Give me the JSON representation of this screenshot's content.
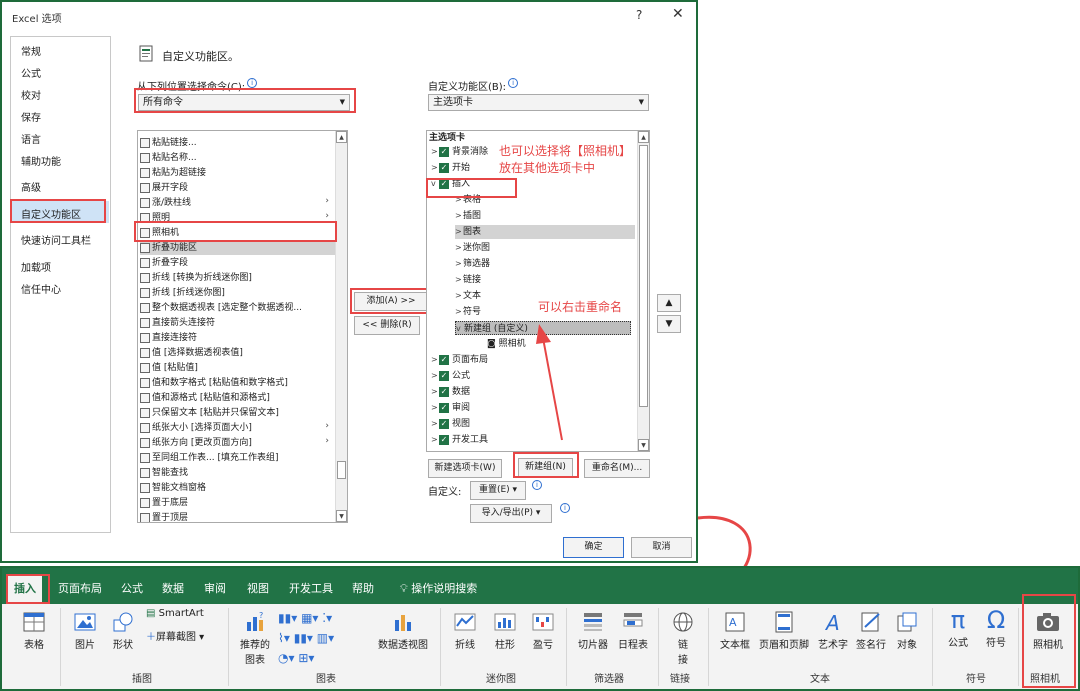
{
  "dialog": {
    "title": "Excel 选项",
    "help": "?",
    "close": "✕",
    "nav": [
      "常规",
      "公式",
      "校对",
      "保存",
      "语言",
      "辅助功能",
      "高级",
      "自定义功能区",
      "快速访问工具栏",
      "加载项",
      "信任中心"
    ],
    "header": "自定义功能区。",
    "choose_label": "从下列位置选择命令(C):",
    "choose_value": "所有命令",
    "ribbon_label": "自定义功能区(B):",
    "ribbon_value": "主选项卡",
    "commands": [
      {
        "text": "粘贴链接...",
        "chev": false
      },
      {
        "text": "粘贴名称...",
        "chev": false
      },
      {
        "text": "粘贴为超链接",
        "chev": false
      },
      {
        "text": "展开字段",
        "chev": false
      },
      {
        "text": "涨/跌柱线",
        "chev": true
      },
      {
        "text": "照明",
        "chev": true
      },
      {
        "text": "照相机",
        "chev": false
      },
      {
        "text": "折叠功能区",
        "chev": false
      },
      {
        "text": "折叠字段",
        "chev": false
      },
      {
        "text": "折线 [转换为折线迷你图]",
        "chev": false
      },
      {
        "text": "折线 [折线迷你图]",
        "chev": false
      },
      {
        "text": "整个数据透视表 [选定整个数据透视...",
        "chev": false
      },
      {
        "text": "直接箭头连接符",
        "chev": false
      },
      {
        "text": "直接连接符",
        "chev": false
      },
      {
        "text": "值 [选择数据透视表值]",
        "chev": false
      },
      {
        "text": "值 [粘贴值]",
        "chev": false
      },
      {
        "text": "值和数字格式 [粘贴值和数字格式]",
        "chev": false
      },
      {
        "text": "值和源格式 [粘贴值和源格式]",
        "chev": false
      },
      {
        "text": "只保留文本 [粘贴并只保留文本]",
        "chev": false
      },
      {
        "text": "纸张大小 [选择页面大小]",
        "chev": true
      },
      {
        "text": "纸张方向 [更改页面方向]",
        "chev": true
      },
      {
        "text": "至同组工作表... [填充工作表组]",
        "chev": false
      },
      {
        "text": "智能查找",
        "chev": false
      },
      {
        "text": "智能文档窗格",
        "chev": false
      },
      {
        "text": "置于底层",
        "chev": false
      },
      {
        "text": "置于顶层",
        "chev": false
      }
    ],
    "add_button": "添加(A) >>",
    "remove_button": "<< 删除(R)",
    "tree_header": "主选项卡",
    "tree": [
      {
        "text": "背景消除",
        "level": 0,
        "exp": ">",
        "check": true
      },
      {
        "text": "开始",
        "level": 0,
        "exp": ">",
        "check": true
      },
      {
        "text": "插入",
        "level": 0,
        "exp": "v",
        "check": true
      },
      {
        "text": "表格",
        "level": 1,
        "exp": ">",
        "check": false
      },
      {
        "text": "插图",
        "level": 1,
        "exp": ">",
        "check": false
      },
      {
        "text": "图表",
        "level": 1,
        "exp": ">",
        "check": false
      },
      {
        "text": "迷你图",
        "level": 1,
        "exp": ">",
        "check": false
      },
      {
        "text": "筛选器",
        "level": 1,
        "exp": ">",
        "check": false
      },
      {
        "text": "链接",
        "level": 1,
        "exp": ">",
        "check": false
      },
      {
        "text": "文本",
        "level": 1,
        "exp": ">",
        "check": false
      },
      {
        "text": "符号",
        "level": 1,
        "exp": ">",
        "check": false
      },
      {
        "text": "新建组 (自定义)",
        "level": 1,
        "exp": "v",
        "check": false
      },
      {
        "text": "照相机",
        "level": 2,
        "exp": "",
        "check": false
      },
      {
        "text": "页面布局",
        "level": 0,
        "exp": ">",
        "check": true
      },
      {
        "text": "公式",
        "level": 0,
        "exp": ">",
        "check": true
      },
      {
        "text": "数据",
        "level": 0,
        "exp": ">",
        "check": true
      },
      {
        "text": "审阅",
        "level": 0,
        "exp": ">",
        "check": true
      },
      {
        "text": "视图",
        "level": 0,
        "exp": ">",
        "check": true
      },
      {
        "text": "开发工具",
        "level": 0,
        "exp": ">",
        "check": true
      }
    ],
    "new_tab_button": "新建选项卡(W)",
    "new_group_button": "新建组(N)",
    "rename_button": "重命名(M)...",
    "customize_label": "自定义:",
    "reset_button": "重置(E) ▾",
    "import_export_button": "导入/导出(P) ▾",
    "ok_button": "确定",
    "cancel_button": "取消",
    "note1_line1": "也可以选择将【照相机】",
    "note1_line2": "放在其他选项卡中",
    "note2": "可以右击重命名"
  },
  "ribbon": {
    "tabs": [
      "插入",
      "页面布局",
      "公式",
      "数据",
      "审阅",
      "视图",
      "开发工具",
      "帮助",
      "操作说明搜索"
    ],
    "buttons": {
      "table": "表格",
      "picture": "图片",
      "shape": "形状",
      "smartart": "SmartArt",
      "screenshot": "屏幕截图",
      "recommended_chart_1": "推荐的",
      "recommended_chart_2": "图表",
      "pivot_chart": "数据透视图",
      "line": "折线",
      "column": "柱形",
      "winloss": "盈亏",
      "slicer": "切片器",
      "timeline": "日程表",
      "link_1": "链",
      "link_2": "接",
      "textbox": "文本框",
      "header_footer": "页眉和页脚",
      "wordart": "艺术字",
      "signature": "签名行",
      "object": "对象",
      "equation": "公式",
      "symbol": "符号",
      "camera": "照相机"
    },
    "groups": {
      "illustrations": "插图",
      "charts": "图表",
      "sparklines": "迷你图",
      "filters": "筛选器",
      "links": "链接",
      "text": "文本",
      "symbols": "符号",
      "camera": "照相机"
    }
  }
}
